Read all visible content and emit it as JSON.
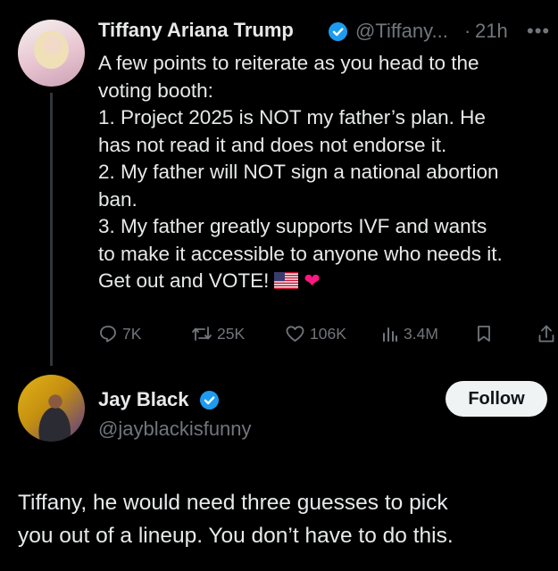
{
  "tweet": {
    "author_name": "Tiffany Ariana Trump",
    "handle": "@Tiffany...",
    "separator": "·",
    "time": "21h",
    "more": "•••",
    "lines": [
      "A few points to reiterate as you head to the",
      "voting booth:",
      "1. Project 2025 is NOT my father’s plan. He",
      "has not read it and does not endorse it.",
      "2. My father will NOT sign a national abortion",
      "ban.",
      "3. My father greatly supports IVF and wants",
      "to make it accessible to anyone who needs it.",
      "Get out and VOTE!"
    ],
    "heart_emoji": "❤",
    "actions": {
      "replies": "7K",
      "reposts": "25K",
      "likes": "106K",
      "views": "3.4M"
    },
    "icons": [
      "reply-icon",
      "repost-icon",
      "like-icon",
      "views-icon",
      "bookmark-icon",
      "share-icon",
      "us-flag-icon",
      "red-heart-icon",
      "verified-badge-icon"
    ]
  },
  "reply": {
    "author_name": "Jay Black",
    "handle": "@jayblackisfunny",
    "follow_label": "Follow",
    "lines": [
      "Tiffany, he would need three guesses to pick",
      "you out of a lineup. You don’t have to do this."
    ]
  },
  "colors": {
    "background": "#000000",
    "text": "#e7e9ea",
    "muted": "#71767b",
    "verified": "#1d9bf0",
    "follow_bg": "#eff3f4"
  }
}
